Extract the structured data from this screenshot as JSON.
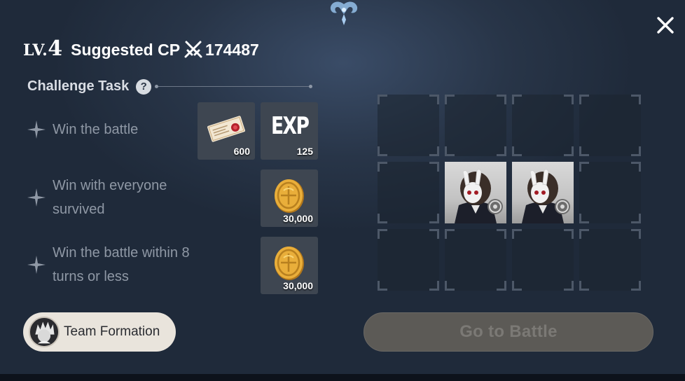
{
  "header": {
    "level_prefix": "LV.",
    "level": "4",
    "cp_label": "Suggested CP",
    "cp_value": "174487"
  },
  "section": {
    "title": "Challenge Task"
  },
  "tasks": [
    {
      "text_lines": [
        "Win the battle"
      ],
      "rewards": [
        {
          "icon": "ticket-icon",
          "qty": "600"
        },
        {
          "icon": "exp-icon",
          "label": "EXP",
          "qty": "125"
        }
      ]
    },
    {
      "text_lines": [
        "Win with everyone",
        "survived"
      ],
      "rewards": [
        {
          "icon": "gold-coin-icon",
          "qty": "30,000"
        }
      ]
    },
    {
      "text_lines": [
        "Win the battle within 8",
        "turns or less"
      ],
      "rewards": [
        {
          "icon": "gold-coin-icon",
          "qty": "30,000"
        }
      ]
    }
  ],
  "formation": {
    "rows": 3,
    "cols": 4,
    "occupied_slots": [
      5,
      6
    ]
  },
  "buttons": {
    "team_formation": "Team Formation",
    "go_to_battle": "Go to Battle"
  },
  "colors": {
    "panel_bg": "#283548",
    "task_text": "#8f98a5",
    "team_button_bg": "#e9e4dc",
    "battle_button_bg": "#5c5a56",
    "battle_button_text": "#7b7975"
  }
}
